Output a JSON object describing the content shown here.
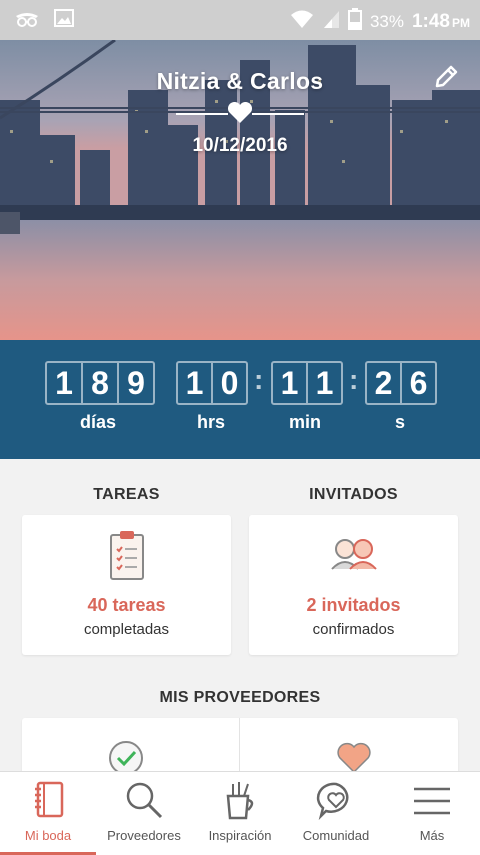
{
  "status_bar": {
    "battery": "33%",
    "time": "1:48",
    "ampm": "PM"
  },
  "hero": {
    "couple": "Nitzia & Carlos",
    "date": "10/12/2016"
  },
  "countdown": {
    "days": [
      "1",
      "8",
      "9"
    ],
    "hours": [
      "1",
      "0"
    ],
    "minutes": [
      "1",
      "1"
    ],
    "seconds": [
      "2",
      "6"
    ],
    "units": {
      "days": "días",
      "hours": "hrs",
      "minutes": "min",
      "seconds": "s"
    }
  },
  "tasks": {
    "title": "TAREAS",
    "value": "40 tareas",
    "caption": "completadas"
  },
  "guests": {
    "title": "INVITADOS",
    "value": "2 invitados",
    "caption": "confirmados"
  },
  "vendors": {
    "title": "MIS PROVEEDORES"
  },
  "nav": {
    "items": [
      {
        "label": "Mi boda",
        "icon": "notebook-icon",
        "active": true
      },
      {
        "label": "Proveedores",
        "icon": "search-icon",
        "active": false
      },
      {
        "label": "Inspiración",
        "icon": "paint-cup-icon",
        "active": false
      },
      {
        "label": "Comunidad",
        "icon": "heart-chat-icon",
        "active": false
      },
      {
        "label": "Más",
        "icon": "menu-icon",
        "active": false
      }
    ]
  },
  "colors": {
    "accent": "#d9675a",
    "countdown_bg": "#1f5a80",
    "statusbar_bg": "#cfcfcf"
  }
}
